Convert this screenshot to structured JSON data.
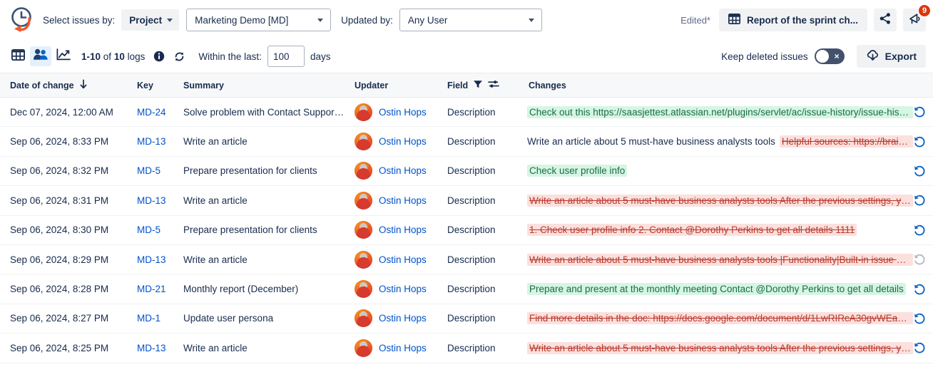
{
  "header": {
    "logo_icon": "clock-history-icon",
    "select_issues_by_label": "Select issues by:",
    "grouping_value": "Project",
    "project_value": "Marketing Demo [MD]",
    "updated_by_label": "Updated by:",
    "updated_by_value": "Any User",
    "edited_status": "Edited*",
    "report_button": "Report of the sprint ch...",
    "report_icon": "table-grid-icon",
    "share_icon": "share-icon",
    "announce_icon": "megaphone-icon",
    "announce_badge": "9"
  },
  "toolbar": {
    "view_table_icon": "table-view-icon",
    "view_people_icon": "people-view-icon",
    "view_chart_icon": "chart-view-icon",
    "active_view": "people-view-icon",
    "count_range": "1-10",
    "count_of": "of",
    "count_total": "10",
    "count_unit": "logs",
    "info_icon": "info-icon",
    "refresh_icon": "refresh-icon",
    "within_label": "Within the last:",
    "days_value": "100",
    "days_placeholder": "days",
    "days_unit": "days",
    "keep_deleted_label": "Keep deleted issues",
    "keep_deleted_on": false,
    "toggle_off_mark": "×",
    "export_label": "Export",
    "export_icon": "cloud-download-icon"
  },
  "table": {
    "columns": {
      "date": "Date of change",
      "sort_icon": "arrow-down-icon",
      "key": "Key",
      "summary": "Summary",
      "updater": "Updater",
      "field": "Field",
      "filter_icon": "funnel-icon",
      "settings_icon": "sliders-icon",
      "changes": "Changes"
    },
    "rows": [
      {
        "date": "Dec 07, 2024, 12:00 AM",
        "key": "MD-24",
        "summary": "Solve problem with Contact Support F...",
        "updater": "Ostin Hops",
        "field": "Description",
        "change_kind": "add",
        "change_added": "Check out this https://saasjettest.atlassian.net/plugins/servlet/ac/issue-history/issue-history?…",
        "change_removed": "",
        "change_plain": "",
        "revert_enabled": true
      },
      {
        "date": "Sep 06, 2024, 8:33 PM",
        "key": "MD-13",
        "summary": "Write an article",
        "updater": "Ostin Hops",
        "field": "Description",
        "change_kind": "mixed",
        "change_added": "",
        "change_removed": "Helpful sources: https://brainstation…",
        "change_plain": "Write an article about 5 must-have business analysts tools",
        "revert_enabled": true
      },
      {
        "date": "Sep 06, 2024, 8:32 PM",
        "key": "MD-5",
        "summary": "Prepare presentation for clients",
        "updater": "Ostin Hops",
        "field": "Description",
        "change_kind": "add",
        "change_added": "Check user profile info",
        "change_removed": "",
        "change_plain": "",
        "revert_enabled": true
      },
      {
        "date": "Sep 06, 2024, 8:31 PM",
        "key": "MD-13",
        "summary": "Write an article",
        "updater": "Ostin Hops",
        "field": "Description",
        "change_kind": "del",
        "change_added": "",
        "change_removed": "Write an article about 5 must-have business analysts tools After the previous settings, you will r…",
        "change_plain": "",
        "revert_enabled": true
      },
      {
        "date": "Sep 06, 2024, 8:30 PM",
        "key": "MD-5",
        "summary": "Prepare presentation for clients",
        "updater": "Ostin Hops",
        "field": "Description",
        "change_kind": "del",
        "change_added": "",
        "change_removed": "1. Check user profile info 2. Contact @Dorothy Perkins to get all details 1111",
        "change_plain": "",
        "revert_enabled": true
      },
      {
        "date": "Sep 06, 2024, 8:29 PM",
        "key": "MD-13",
        "summary": "Write an article",
        "updater": "Ostin Hops",
        "field": "Description",
        "change_kind": "del",
        "change_added": "",
        "change_removed": "Write an article about 5 must-have business analysts tools |Functionality|Built-in issue history|Is…",
        "change_plain": "",
        "revert_enabled": false
      },
      {
        "date": "Sep 06, 2024, 8:28 PM",
        "key": "MD-21",
        "summary": "Monthly report (December)",
        "updater": "Ostin Hops",
        "field": "Description",
        "change_kind": "add",
        "change_added": "Prepare and present at the monthly meeting Contact @Dorothy Perkins to get all details",
        "change_removed": "",
        "change_plain": "",
        "revert_enabled": true
      },
      {
        "date": "Sep 06, 2024, 8:27 PM",
        "key": "MD-1",
        "summary": "Update user persona",
        "updater": "Ostin Hops",
        "field": "Description",
        "change_kind": "del",
        "change_added": "",
        "change_removed": "Find more details in the doc: https://docs.google.com/document/d/1LwRIRcA30gvWEa5OzD6_…",
        "change_plain": "",
        "revert_enabled": true
      },
      {
        "date": "Sep 06, 2024, 8:25 PM",
        "key": "MD-13",
        "summary": "Write an article",
        "updater": "Ostin Hops",
        "field": "Description",
        "change_kind": "del",
        "change_added": "",
        "change_removed": "Write an article about 5 must-have business analysts tools After the previous settings, you will r…",
        "change_plain": "",
        "revert_enabled": true
      }
    ]
  },
  "colors": {
    "link": "#0052cc",
    "text": "#172b4d",
    "added_bg": "#d6f5e3",
    "removed_bg": "#fbe0de",
    "badge": "#de350b",
    "accent_orange": "#f05a28"
  }
}
